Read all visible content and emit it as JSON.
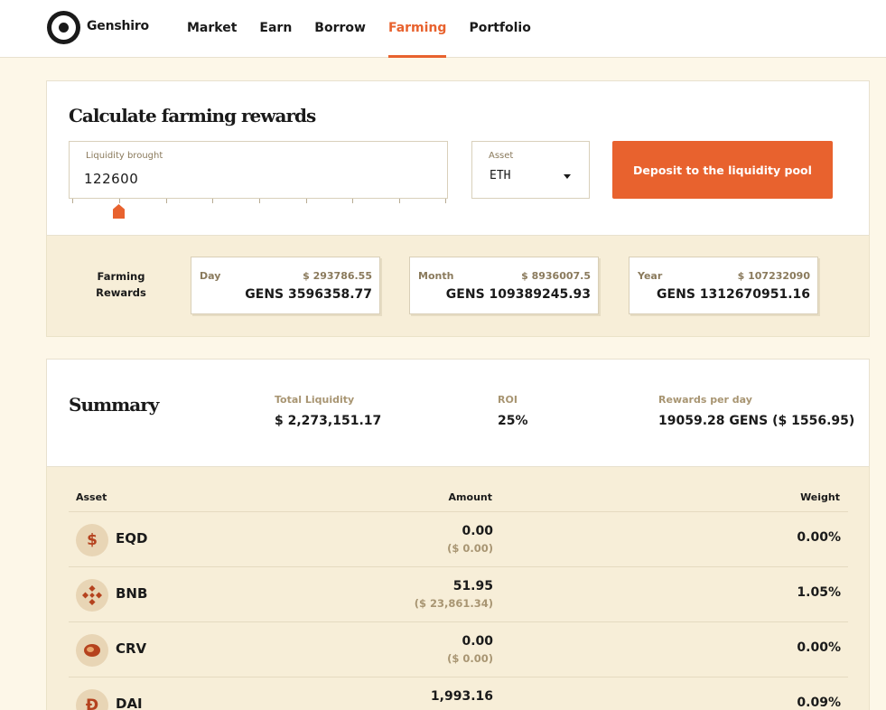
{
  "header": {
    "brand": "Genshiro",
    "nav": [
      "Market",
      "Earn",
      "Borrow",
      "Farming",
      "Portfolio"
    ],
    "active_nav": "Farming"
  },
  "calculator": {
    "title": "Calculate farming rewards",
    "liquidity_label": "Liquidity brought",
    "liquidity_value": "122600",
    "asset_label": "Asset",
    "asset_value": "ETH",
    "deposit_button": "Deposit to the liquidity pool"
  },
  "rewards": {
    "label": "Farming Rewards",
    "cards": [
      {
        "period": "Day",
        "usd": "$ 293786.55",
        "gens": "GENS 3596358.77"
      },
      {
        "period": "Month",
        "usd": "$ 8936007.5",
        "gens": "GENS 109389245.93"
      },
      {
        "period": "Year",
        "usd": "$ 107232090",
        "gens": "GENS 1312670951.16"
      }
    ]
  },
  "summary": {
    "title": "Summary",
    "total_liquidity_label": "Total Liquidity",
    "total_liquidity_value": "$ 2,273,151.17",
    "roi_label": "ROI",
    "roi_value": "25%",
    "rewards_per_day_label": "Rewards per day",
    "rewards_per_day_value": "19059.28 GENS ($ 1556.95)"
  },
  "table": {
    "headers": {
      "asset": "Asset",
      "amount": "Amount",
      "weight": "Weight"
    },
    "rows": [
      {
        "asset": "EQD",
        "icon": "dollar-icon",
        "amount": "0.00",
        "amount_usd": "($ 0.00)",
        "weight": "0.00%"
      },
      {
        "asset": "BNB",
        "icon": "bnb-icon",
        "amount": "51.95",
        "amount_usd": "($ 23,861.34)",
        "weight": "1.05%"
      },
      {
        "asset": "CRV",
        "icon": "crv-icon",
        "amount": "0.00",
        "amount_usd": "($ 0.00)",
        "weight": "0.00%"
      },
      {
        "asset": "DAI",
        "icon": "dai-icon",
        "amount": "1,993.16",
        "amount_usd": "",
        "weight": "0.09%"
      }
    ]
  },
  "colors": {
    "accent": "#e8622e",
    "band": "#f7eed8",
    "background": "#fdf7e8"
  }
}
